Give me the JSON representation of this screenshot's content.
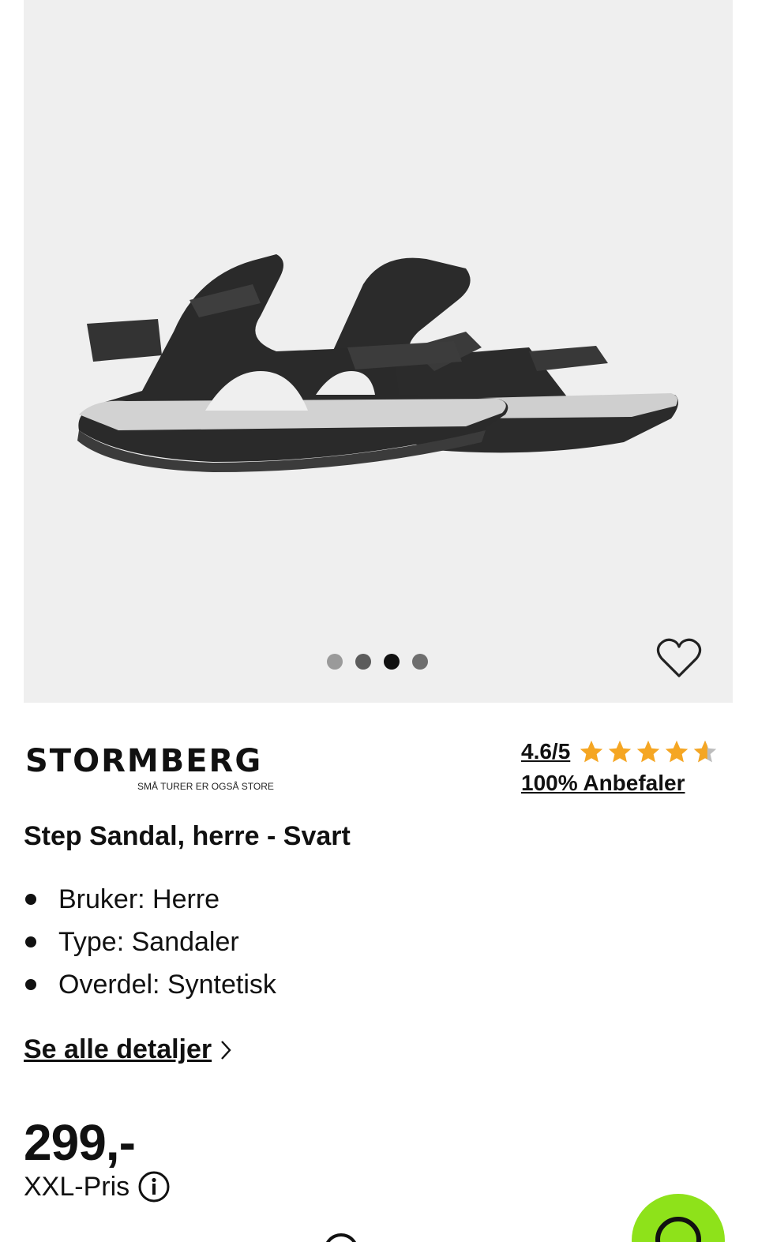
{
  "gallery": {
    "image_alt": "Step Sandal, herre - Svart",
    "dots_count": 4,
    "active_dot": 3,
    "wishlist_icon": "heart-outline-icon"
  },
  "brand": {
    "name": "STORMBERG",
    "tagline": "SMÅ TURER ER OGSÅ STORE"
  },
  "rating": {
    "score": "4.6/5",
    "stars_value": 4.6,
    "stars_max": 5,
    "star_color": "#f5a623",
    "recommend": "100% Anbefaler"
  },
  "product": {
    "title": "Step Sandal, herre - Svart",
    "specs": [
      "Bruker: Herre",
      "Type: Sandaler",
      "Overdel: Syntetisk"
    ],
    "details_link": "Se alle detaljer"
  },
  "price": {
    "amount": "299,-",
    "label": "XXL-Pris"
  },
  "colors": {
    "fab": "#8ee21a",
    "gallery_bg": "#efefef"
  }
}
